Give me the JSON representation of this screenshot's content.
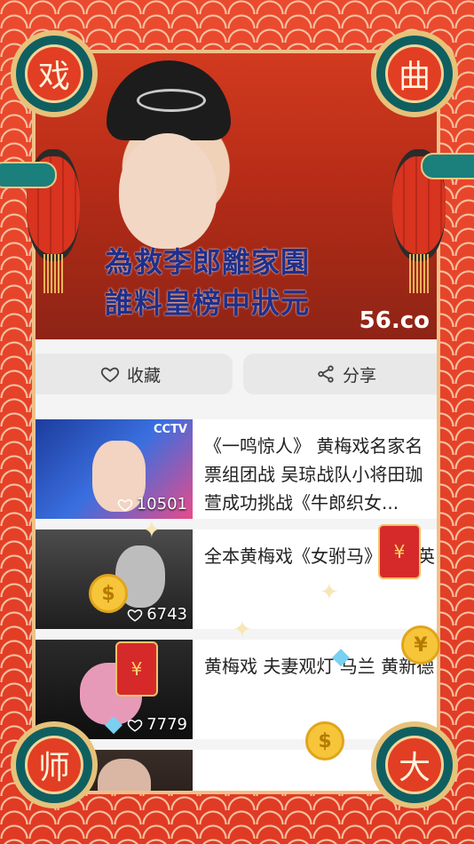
{
  "video": {
    "subtitle_line1": "為救李郎離家園",
    "subtitle_line2": "誰料皇榜中狀元",
    "watermark": "56.co"
  },
  "actions": {
    "favorite_label": "收藏",
    "share_label": "分享"
  },
  "list": [
    {
      "title": "《一鸣惊人》 黄梅戏名家名票组团战 吴琼战队小将田珈萱成功挑战《牛郎织女...",
      "likes": "10501",
      "thumb_badge": "CCTV"
    },
    {
      "title": "全本黄梅戏《女驸马》严凤英",
      "likes": "6743"
    },
    {
      "title": "黄梅戏 夫妻观灯 马兰 黄新德",
      "likes": "7779"
    },
    {
      "title": "",
      "likes": ""
    }
  ],
  "corners": {
    "top_left": "戏",
    "top_right": "曲",
    "bottom_left": "师",
    "bottom_right": "大"
  },
  "decor": {
    "coin_symbol": "$",
    "redpack_symbol": "¥"
  },
  "colors": {
    "background": "#e8452f",
    "medal_ring": "#e6c27a",
    "medal_teal": "#0f5f61"
  }
}
